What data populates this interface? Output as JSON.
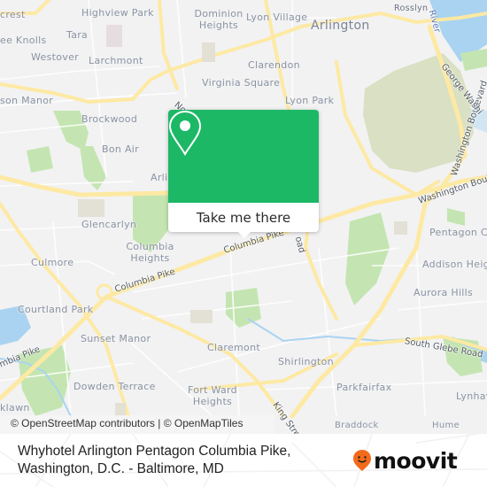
{
  "map": {
    "places": [
      {
        "name": "Highview Park",
        "kind": "neighborhood"
      },
      {
        "name": "Dominion Heights",
        "kind": "neighborhood"
      },
      {
        "name": "Lyon Village",
        "kind": "neighborhood"
      },
      {
        "name": "Arlington",
        "kind": "city"
      },
      {
        "name": "Rosslyn",
        "kind": "small"
      },
      {
        "name": "crest",
        "kind": "neighborhood"
      },
      {
        "name": "ee Knolls",
        "kind": "neighborhood"
      },
      {
        "name": "Tara",
        "kind": "neighborhood"
      },
      {
        "name": "Westover",
        "kind": "neighborhood"
      },
      {
        "name": "Larchmont",
        "kind": "neighborhood"
      },
      {
        "name": "Clarendon",
        "kind": "neighborhood"
      },
      {
        "name": "Virginia Square",
        "kind": "neighborhood"
      },
      {
        "name": "son Manor",
        "kind": "neighborhood"
      },
      {
        "name": "Lyon Park",
        "kind": "neighborhood"
      },
      {
        "name": "Brockwood",
        "kind": "neighborhood"
      },
      {
        "name": "Bon Air",
        "kind": "neighborhood"
      },
      {
        "name": "Arli",
        "kind": "neighborhood"
      },
      {
        "name": "Glencarlyn",
        "kind": "neighborhood"
      },
      {
        "name": "Columbia Heights",
        "kind": "neighborhood"
      },
      {
        "name": "Culmore",
        "kind": "neighborhood"
      },
      {
        "name": "Pentagon Ci",
        "kind": "neighborhood"
      },
      {
        "name": "Addison Heig",
        "kind": "neighborhood"
      },
      {
        "name": "Courtland Park",
        "kind": "neighborhood"
      },
      {
        "name": "Aurora Hills",
        "kind": "neighborhood"
      },
      {
        "name": "Sunset Manor",
        "kind": "neighborhood"
      },
      {
        "name": "Claremont",
        "kind": "neighborhood"
      },
      {
        "name": "Shirlington",
        "kind": "neighborhood"
      },
      {
        "name": "Dowden Terrace",
        "kind": "neighborhood"
      },
      {
        "name": "Fort Ward Heights",
        "kind": "neighborhood"
      },
      {
        "name": "Parkfairfax",
        "kind": "neighborhood"
      },
      {
        "name": "Lynhav",
        "kind": "neighborhood"
      },
      {
        "name": "klawn",
        "kind": "neighborhood"
      },
      {
        "name": "Braddock",
        "kind": "neighborhood"
      },
      {
        "name": "Hume",
        "kind": "neighborhood"
      }
    ],
    "roads": [
      {
        "name": "Columbia Pike"
      },
      {
        "name": "Columbia Pike"
      },
      {
        "name": "mbia Pike"
      },
      {
        "name": "Washington Boulevard"
      },
      {
        "name": "Washington Boulevard"
      },
      {
        "name": "George Washi"
      },
      {
        "name": "South Glebe Road"
      },
      {
        "name": "King Stre"
      },
      {
        "name": "Nort"
      },
      {
        "name": "River"
      },
      {
        "name": "oad"
      }
    ],
    "attribution": "© OpenStreetMap contributors | © OpenMapTiles"
  },
  "popup": {
    "icon": "location-pin-icon",
    "button_label": "Take me there",
    "color": "#1db866"
  },
  "footer": {
    "title": "Whyhotel Arlington Pentagon Columbia Pike, Washington, D.C. - Baltimore, MD",
    "logo_text": "moovit",
    "logo_color": "#f26b1d"
  }
}
